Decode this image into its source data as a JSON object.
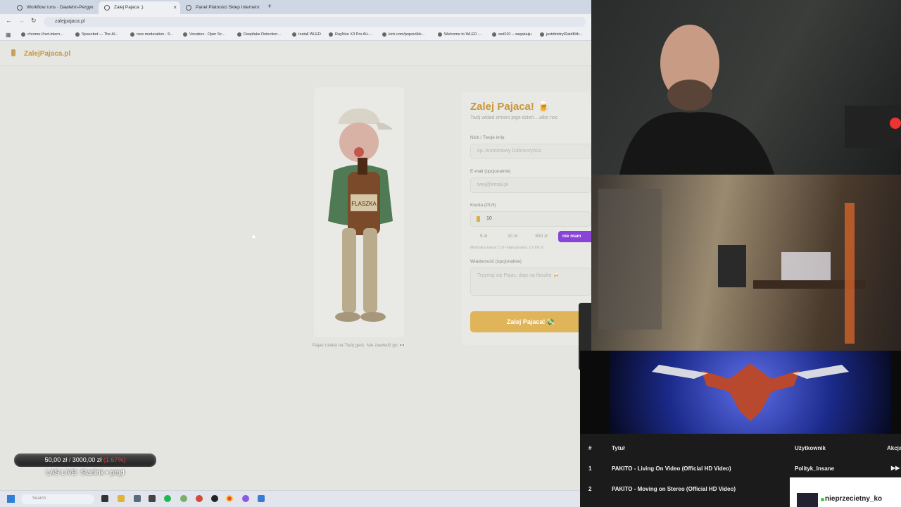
{
  "browser": {
    "tabs": [
      {
        "label": "Workflow runs · Dawiehn-Pergy"
      },
      {
        "label": "Zalej Pajaca ;)"
      },
      {
        "label": "Panel Platności Sklep Internet"
      }
    ],
    "url": "zalejpajaca.pl",
    "bookmarks": [
      "chrome://net-intern...",
      "Spacebot — The AI...",
      "new moderation - S...",
      "Vocabox - Oper Sc...",
      "Deepfake Detection...",
      "Install WLED",
      "RayNeo X3 Pro AI+...",
      "kick.com/popout/kk...",
      "Welcome to WLED -...",
      "ssd101 – zaqakaiju",
      "justdimitry/RaidKith..."
    ]
  },
  "site": {
    "logo": "ZalejPajaca.pl",
    "hero_caption": "Pajac czeka na Twój gest. Nie zawiedź go. 👀",
    "form": {
      "title": "Zalej Pajaca! 🍺",
      "subtitle": "Twój wkład zmieni jego dzień... albo noc",
      "nick_label": "Nick / Twoje imię",
      "nick_placeholder": "np. Anonimowy Dobroczyńca",
      "email_label": "E-mail (opcjonalnie)",
      "email_placeholder": "twoj@email.pl",
      "amount_label": "Kwota (PLN)",
      "amount_value": "10",
      "presets": [
        "5 zł",
        "10 zł",
        "500 zł"
      ],
      "more_button": "nie mam",
      "minmax": "Minimalna kwota: 5 zł • Maksymalna: 10 000 zł",
      "message_label": "Wiadomość (opcjonalnie)",
      "message_placeholder": "Trzymaj się Pajac, daję na flaszkę 🍻",
      "submit": "Zalej Pajaca! 💸"
    }
  },
  "taskbar": {
    "search_placeholder": "Search"
  },
  "overlay": {
    "goal_current": "50,00 zł",
    "goal_separator": "/",
    "goal_target": "3000,00 zł",
    "goal_percent": "(1.67%)",
    "goal_fraction": 0.0167,
    "live_title": "LAS LIVE: Starlink • prąd"
  },
  "queue": {
    "headers": {
      "num": "#",
      "title": "Tytuł",
      "user": "Użytkownik",
      "action": "Akcja"
    },
    "rows": [
      {
        "num": "1",
        "title": "PAKITO - Living On Video (Official HD Video)",
        "user": "Polityk_Insane"
      },
      {
        "num": "2",
        "title": "PAKITO - Moving on Stereo (Official HD Video)",
        "user": ""
      }
    ]
  },
  "chat": {
    "username": "nieprzecietny_ko"
  },
  "colors": {
    "accent": "#c9973c",
    "button": "#e0b559",
    "more": "#8a43d8",
    "goal_red": "#e5383b"
  }
}
